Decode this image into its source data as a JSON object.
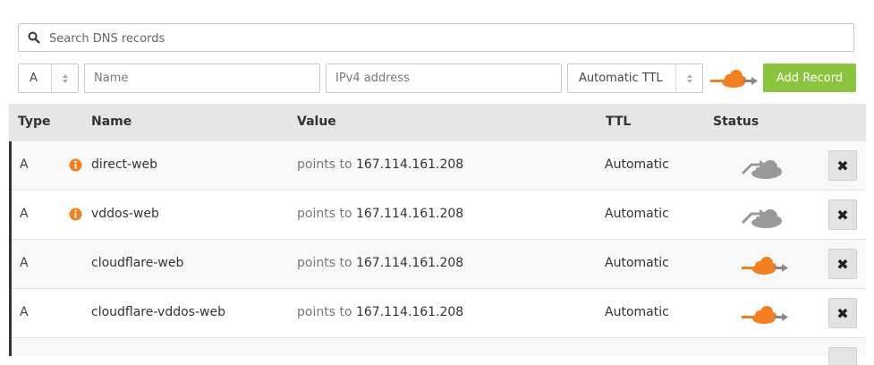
{
  "search": {
    "placeholder": "Search DNS records",
    "icon": "search-icon"
  },
  "add_form": {
    "type_value": "A",
    "name_placeholder": "Name",
    "ipv4_placeholder": "IPv4 address",
    "ttl_value": "Automatic TTL",
    "proxy_icon": "orange-cloud-icon",
    "add_label": "Add Record"
  },
  "table": {
    "headers": {
      "type": "Type",
      "name": "Name",
      "value": "Value",
      "ttl": "TTL",
      "status": "Status"
    },
    "points_to_label": "points to",
    "rows": [
      {
        "type": "A",
        "name": "direct-web",
        "ip": "167.114.161.208",
        "ttl": "Automatic",
        "proxied": false,
        "warning": true
      },
      {
        "type": "A",
        "name": "vddos-web",
        "ip": "167.114.161.208",
        "ttl": "Automatic",
        "proxied": false,
        "warning": true
      },
      {
        "type": "A",
        "name": "cloudflare-web",
        "ip": "167.114.161.208",
        "ttl": "Automatic",
        "proxied": true,
        "warning": false
      },
      {
        "type": "A",
        "name": "cloudflare-vddos-web",
        "ip": "167.114.161.208",
        "ttl": "Automatic",
        "proxied": true,
        "warning": false
      }
    ],
    "delete_glyph": "✖"
  },
  "colors": {
    "accent_green": "#8ac43f",
    "cloud_orange": "#f38020",
    "cloud_gray": "#999999",
    "warning_orange": "#f38020"
  }
}
